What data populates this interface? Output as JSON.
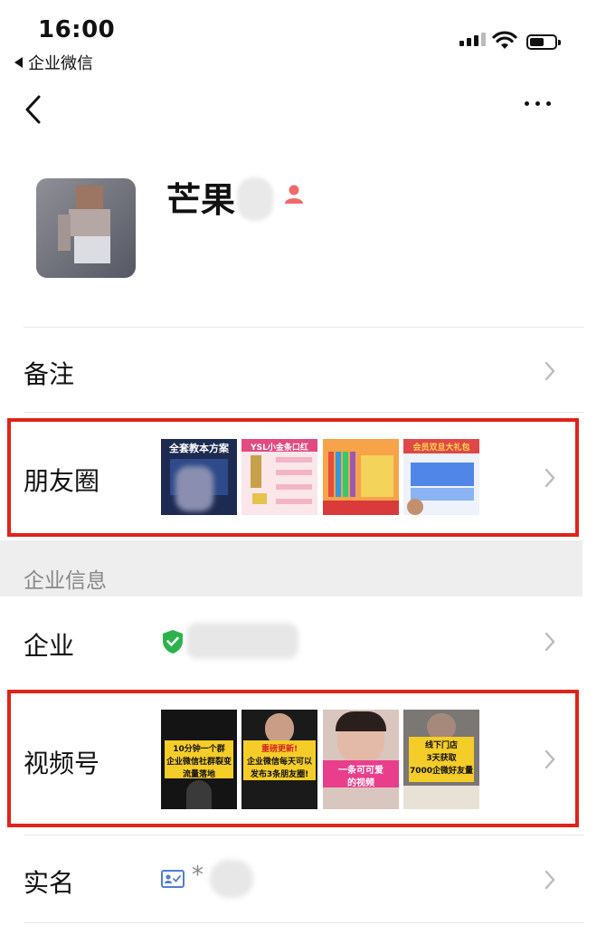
{
  "status_bar": {
    "time": "16:00",
    "back_app": "企业微信"
  },
  "profile": {
    "name": "芒果"
  },
  "rows": {
    "remark": "备注",
    "moments": "朋友圈",
    "company_section": "企业信息",
    "company": "企业",
    "channels": "视频号",
    "real_name": "实名",
    "real_name_value": "*"
  },
  "moments_thumbs": [
    {
      "text": "全套教本方案"
    },
    {
      "text": "YSL小金条口红"
    },
    {
      "text": ""
    },
    {
      "text": "会员双旦大礼包"
    }
  ],
  "channel_thumbs": [
    {
      "line1": "10分钟一个群",
      "line2": "企业微信社群裂变",
      "line3": "流量落地"
    },
    {
      "line1": "重磅更新!",
      "line2": "企业微信每天可以",
      "line3": "发布3条朋友圈!"
    },
    {
      "line1": "一条可可爱",
      "line2": "的视频",
      "line3": ""
    },
    {
      "line1": "线下门店",
      "line2": "3天获取",
      "line3": "7000企微好友量"
    }
  ],
  "colors": {
    "highlight": "#e0231b",
    "verified": "#2bb24c"
  }
}
